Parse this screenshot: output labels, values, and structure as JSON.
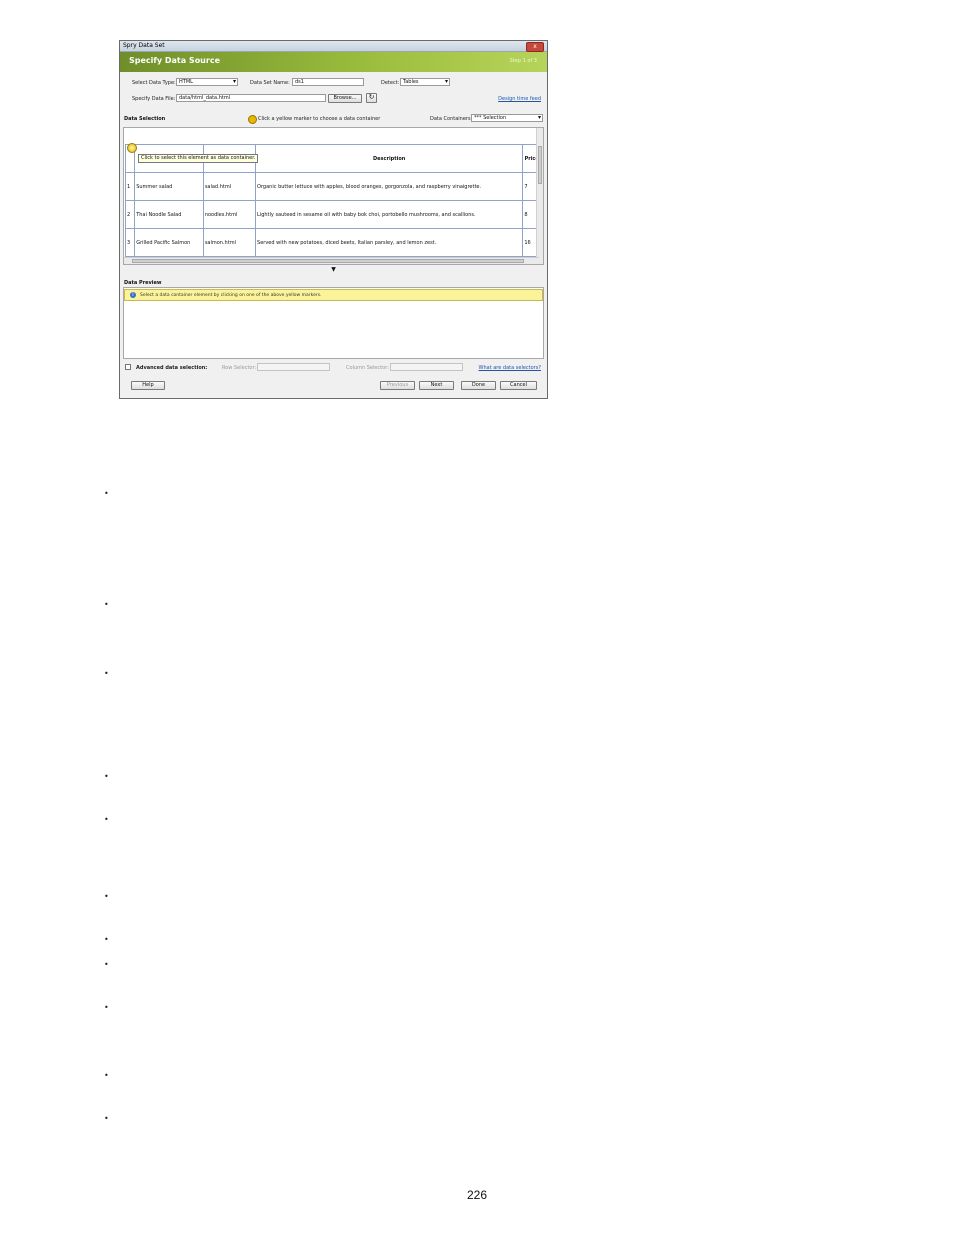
{
  "dialog": {
    "window_title": "Spry Data Set",
    "close_glyph": "x",
    "header_title": "Specify Data Source",
    "step": "Step 1 of 3",
    "select_data_type_label": "Select Data Type:",
    "data_type_value": "HTML",
    "data_set_name_label": "Data Set Name:",
    "data_set_name_value": "ds1",
    "detect_label": "Detect:",
    "detect_value": "Tables",
    "specify_data_file_label": "Specify Data File:",
    "data_file_value": "data/html_data.html",
    "browse_label": "Browse...",
    "refresh_glyph": "↻",
    "design_time_feed_link": "Design time feed",
    "data_selection_label": "Data Selection",
    "hint_text": "Click a yellow marker to choose a data container",
    "data_containers_label": "Data Containers:",
    "data_containers_value": "*** Selection",
    "tooltip": "Click to select this element as data container.",
    "table": {
      "headers": [
        "",
        "",
        "",
        "Description",
        "Price"
      ],
      "rows": [
        [
          "1",
          "Summer salad",
          "salad.html",
          "Organic butter lettuce with apples, blood oranges, gorgonzola, and raspberry vinaigrette.",
          "7"
        ],
        [
          "2",
          "Thai Noodle Salad",
          "noodles.html",
          "Lightly sauteed in sesame oil with baby bok choi, portobello mushrooms, and scallions.",
          "8"
        ],
        [
          "3",
          "Grilled Pacific Salmon",
          "salmon.html",
          "Served with new potatoes, diced beets, Italian parsley, and lemon zest.",
          "16"
        ]
      ]
    },
    "splitter_glyph": "▼",
    "data_preview_label": "Data Preview",
    "info_icon_glyph": "i",
    "preview_message": "Select a data container element by clicking on one of the above yellow markers.",
    "advanced_label": "Advanced data selection:",
    "row_selector_label": "Row Selector:",
    "column_selector_label": "Column Selector:",
    "advanced_help_link": "What are data selectors?",
    "buttons": {
      "help": "Help",
      "previous": "Previous",
      "next": "Next",
      "done": "Done",
      "cancel": "Cancel"
    }
  },
  "bullets": [
    "•",
    "•",
    "•",
    "•",
    "•",
    "•",
    "•",
    "•",
    "•",
    "•",
    "•"
  ],
  "page_number": "226"
}
